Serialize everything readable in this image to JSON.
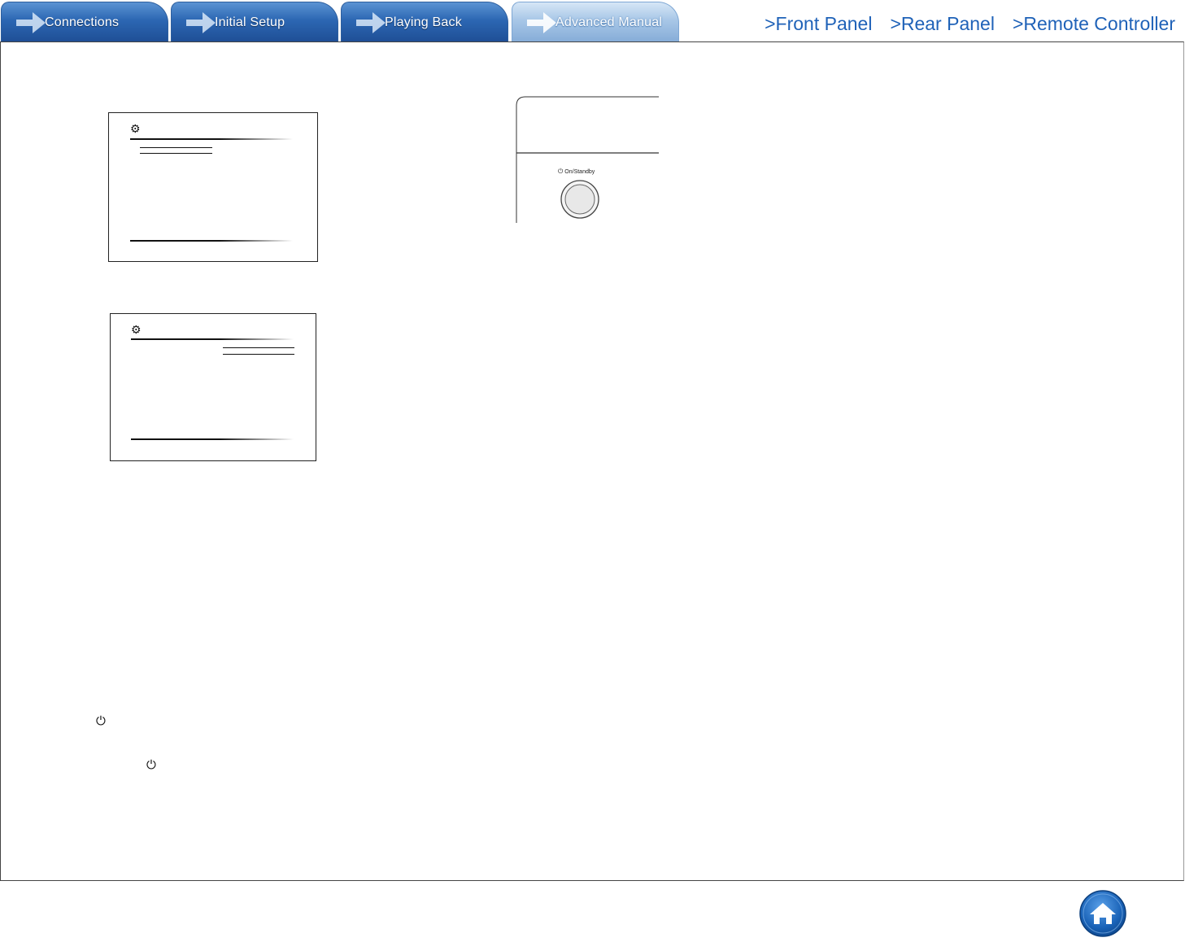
{
  "tabs": [
    {
      "label": "Connections",
      "active": false
    },
    {
      "label": "Initial Setup",
      "active": false
    },
    {
      "label": "Playing Back",
      "active": false
    },
    {
      "label": "Advanced Manual",
      "active": true
    }
  ],
  "nav_links": [
    {
      "label": ">Front Panel"
    },
    {
      "label": ">Rear Panel"
    },
    {
      "label": ">Remote Controller"
    }
  ],
  "front_panel": {
    "button_label": "On/Standby"
  },
  "icons": {
    "tab_arrow": "arrow-right-icon",
    "menu": "gear-icon",
    "power": "power-icon",
    "home": "home-icon"
  },
  "colors": {
    "tab_blue": "#2c67b3",
    "tab_active": "#a8c7e7",
    "link_blue": "#1f62b8",
    "home_blue": "#1a63b8"
  }
}
